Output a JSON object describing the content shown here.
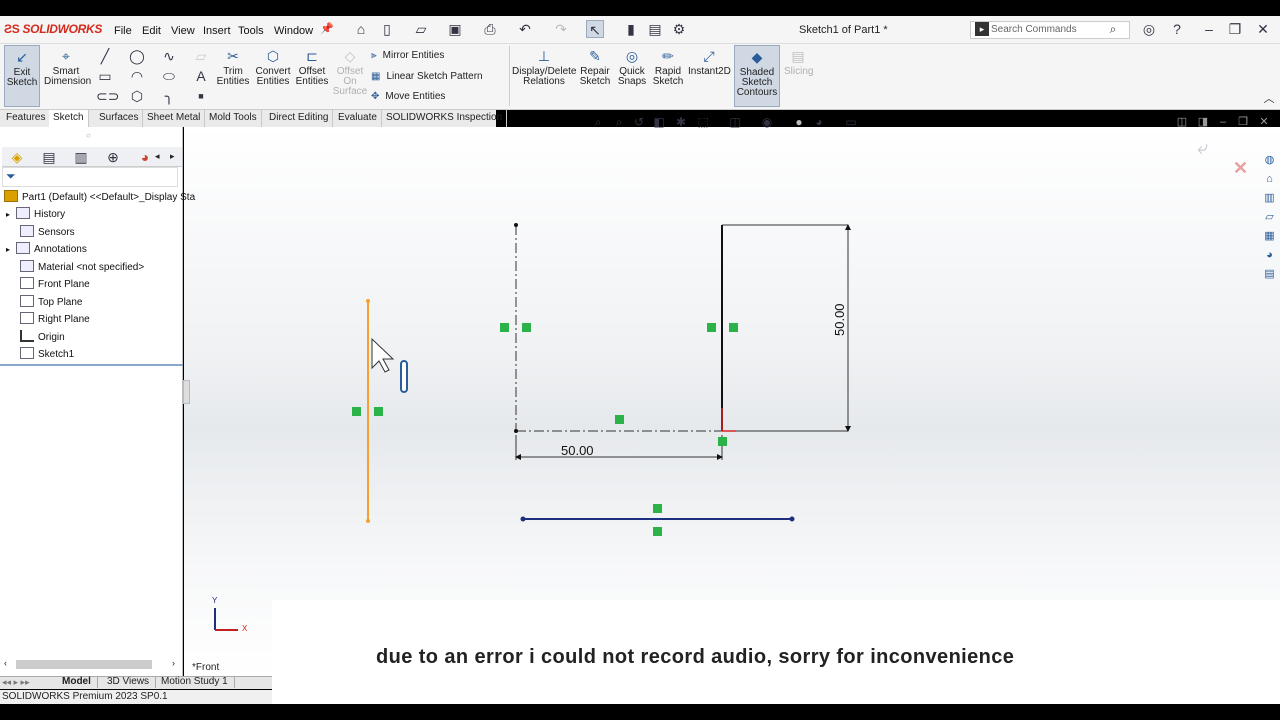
{
  "app": {
    "logo": "SOLIDWORKS",
    "doc_title": "Sketch1 of Part1 *"
  },
  "menu": [
    "File",
    "Edit",
    "View",
    "Insert",
    "Tools",
    "Window"
  ],
  "search": {
    "placeholder": "Search Commands"
  },
  "ribbon": {
    "exit_sketch": "Exit\nSketch",
    "smart_dimension": "Smart\nDimension",
    "trim": "Trim\nEntities",
    "convert": "Convert\nEntities",
    "offset": "Offset\nEntities",
    "offset_surface": "Offset\nOn\nSurface",
    "mirror": "Mirror Entities",
    "linear_pattern": "Linear Sketch Pattern",
    "move": "Move Entities",
    "display_delete": "Display/Delete\nRelations",
    "repair": "Repair\nSketch",
    "quick_snaps": "Quick\nSnaps",
    "rapid_sketch": "Rapid\nSketch",
    "instant2d": "Instant2D",
    "shaded": "Shaded\nSketch\nContours",
    "slicing": "Slicing"
  },
  "tabs": [
    "Features",
    "Sketch",
    "Surfaces",
    "Sheet Metal",
    "Mold Tools",
    "Direct Editing",
    "Evaluate",
    "SOLIDWORKS Inspection"
  ],
  "tree": {
    "root": "Part1 (Default) <<Default>_Display Sta",
    "items": [
      "History",
      "Sensors",
      "Annotations",
      "Material <not specified>",
      "Front Plane",
      "Top Plane",
      "Right Plane",
      "Origin",
      "Sketch1"
    ]
  },
  "dimensions": {
    "vertical": "50.00",
    "horizontal": "50.00"
  },
  "triad": {
    "x": "X",
    "y": "Y"
  },
  "view_label": "*Front",
  "bottom_tabs": [
    "Model",
    "3D Views",
    "Motion Study 1"
  ],
  "status": "SOLIDWORKS Premium 2023 SP0.1",
  "caption": "due to an error i could not record audio, sorry for inconvenience"
}
